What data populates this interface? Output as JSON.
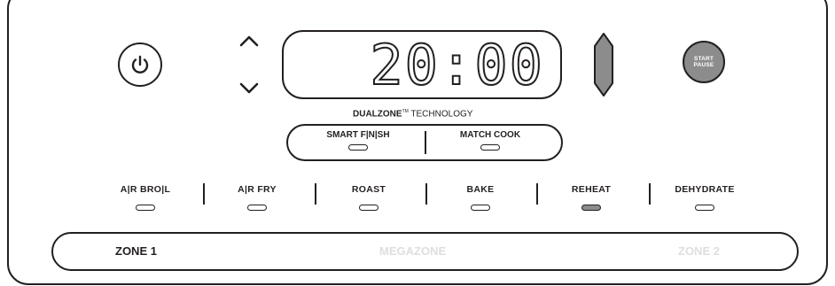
{
  "display": {
    "time": "20:00"
  },
  "start_button": {
    "line1": "START",
    "line2": "PAUSE"
  },
  "technology": {
    "brand": "DUALZONE",
    "tm": "TM",
    "suffix": "TECHNOLOGY"
  },
  "dual_modes": [
    {
      "label": "SMART F|N|SH",
      "active": false
    },
    {
      "label": "MATCH COOK",
      "active": false
    }
  ],
  "functions": [
    {
      "label": "A|R BRO|L",
      "active": false
    },
    {
      "label": "A|R FRY",
      "active": false
    },
    {
      "label": "ROAST",
      "active": false
    },
    {
      "label": "BAKE",
      "active": false
    },
    {
      "label": "REHEAT",
      "active": true
    },
    {
      "label": "DEHYDRATE",
      "active": false
    }
  ],
  "zones": {
    "zone1": "ZONE 1",
    "megazone": "MEGAZONE",
    "zone2": "ZONE 2"
  },
  "colors": {
    "ink": "#231f20",
    "active_fill": "#8c8c8c",
    "dim_text": "#dedede"
  },
  "icons": [
    "power-icon",
    "chevron-up-icon",
    "chevron-down-icon",
    "diamond-arrow-icon"
  ]
}
